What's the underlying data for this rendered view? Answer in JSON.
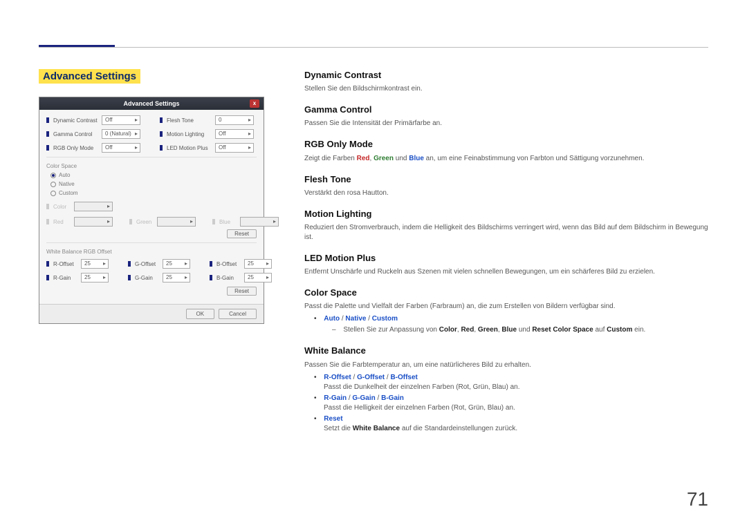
{
  "page_number": "71",
  "section_title": "Advanced Settings",
  "dialog": {
    "title": "Advanced Settings",
    "close_x": "x",
    "fields": {
      "dynamic_contrast": {
        "label": "Dynamic Contrast",
        "value": "Off"
      },
      "flesh_tone": {
        "label": "Flesh Tone",
        "value": "0"
      },
      "gamma_control": {
        "label": "Gamma Control",
        "value": "0 (Natural)"
      },
      "motion_lighting": {
        "label": "Motion Lighting",
        "value": "Off"
      },
      "rgb_only": {
        "label": "RGB Only Mode",
        "value": "Off"
      },
      "led_motion_plus": {
        "label": "LED Motion Plus",
        "value": "Off"
      }
    },
    "color_space": {
      "label": "Color Space",
      "options": {
        "auto": "Auto",
        "native": "Native",
        "custom": "Custom"
      },
      "selected": "auto",
      "color": {
        "label": "Color",
        "value": ""
      },
      "red": {
        "label": "Red",
        "value": ""
      },
      "green": {
        "label": "Green",
        "value": ""
      },
      "blue": {
        "label": "Blue",
        "value": ""
      },
      "reset": "Reset"
    },
    "white_balance": {
      "label": "White Balance RGB Offset",
      "r_offset": {
        "label": "R-Offset",
        "value": "25"
      },
      "g_offset": {
        "label": "G-Offset",
        "value": "25"
      },
      "b_offset": {
        "label": "B-Offset",
        "value": "25"
      },
      "r_gain": {
        "label": "R-Gain",
        "value": "25"
      },
      "g_gain": {
        "label": "G-Gain",
        "value": "25"
      },
      "b_gain": {
        "label": "B-Gain",
        "value": "25"
      },
      "reset": "Reset"
    },
    "ok": "OK",
    "cancel": "Cancel"
  },
  "content": {
    "dynamic_contrast": {
      "h": "Dynamic Contrast",
      "p": "Stellen Sie den Bildschirmkontrast ein."
    },
    "gamma_control": {
      "h": "Gamma Control",
      "p": "Passen Sie die Intensität der Primärfarbe an."
    },
    "rgb_only": {
      "h": "RGB Only Mode",
      "p1": "Zeigt die Farben ",
      "red": "Red",
      "c1": ", ",
      "green": "Green",
      "and": " und ",
      "blue": "Blue",
      "p2": " an, um eine Feinabstimmung von Farbton und Sättigung vorzunehmen."
    },
    "flesh_tone": {
      "h": "Flesh Tone",
      "p": "Verstärkt den rosa Hautton."
    },
    "motion_lighting": {
      "h": "Motion Lighting",
      "p": "Reduziert den Stromverbrauch, indem die Helligkeit des Bildschirms verringert wird, wenn das Bild auf dem Bildschirm in Bewegung ist."
    },
    "led_motion_plus": {
      "h": "LED Motion Plus",
      "p": "Entfernt Unschärfe und Ruckeln aus Szenen mit vielen schnellen Bewegungen, um ein schärferes Bild zu erzielen."
    },
    "color_space": {
      "h": "Color Space",
      "p": "Passt die Palette und Vielfalt der Farben (Farbraum) an, die zum Erstellen von Bildern verfügbar sind.",
      "opts": {
        "auto": "Auto",
        "sep": " / ",
        "native": "Native",
        "custom": "Custom"
      },
      "sub_p1": "Stellen Sie zur Anpassung von ",
      "color": "Color",
      "c1": ", ",
      "red": "Red",
      "c2": ", ",
      "green": "Green",
      "c3": ", ",
      "blue": "Blue",
      "and": " und ",
      "reset": "Reset Color Space",
      "on": " auf ",
      "custom2": "Custom",
      "end": " ein."
    },
    "white_balance": {
      "h": "White Balance",
      "p": "Passen Sie die Farbtemperatur an, um eine natürlicheres Bild zu erhalten.",
      "offset": {
        "r": "R-Offset",
        "sep": " / ",
        "g": "G-Offset",
        "b": "B-Offset",
        "desc": "Passt die Dunkelheit der einzelnen Farben (Rot, Grün, Blau) an."
      },
      "gain": {
        "r": "R-Gain",
        "sep": " / ",
        "g": "G-Gain",
        "b": "B-Gain",
        "desc": "Passt die Helligkeit der einzelnen Farben (Rot, Grün, Blau) an."
      },
      "reset": {
        "label": "Reset",
        "desc1": "Setzt die ",
        "wb": "White Balance",
        "desc2": " auf die Standardeinstellungen zurück."
      }
    }
  }
}
